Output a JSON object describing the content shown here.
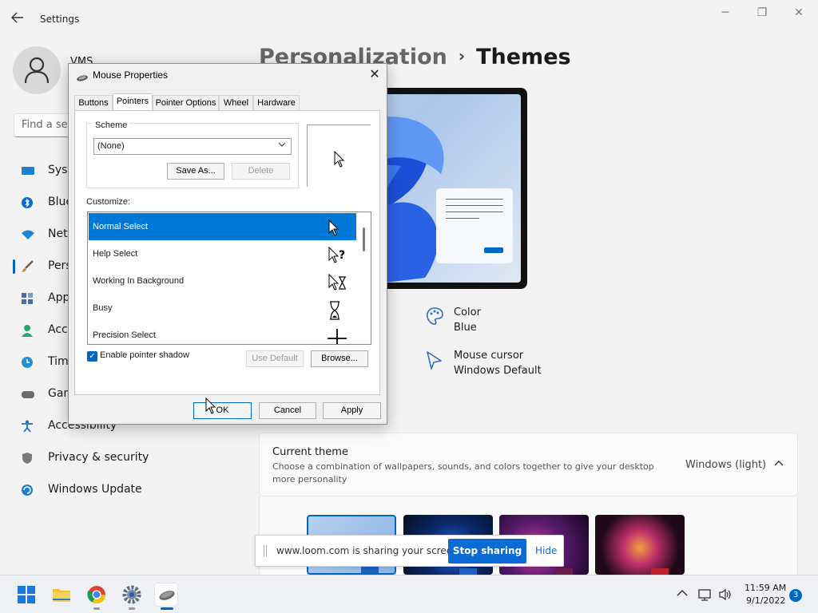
{
  "settings": {
    "app_title": "Settings",
    "user_name": "VMS",
    "search_placeholder": "Find a set",
    "nav": [
      {
        "label": "System",
        "icon": "system-icon",
        "color": "#1e7fcf"
      },
      {
        "label": "Bluetooth & devices",
        "icon": "bluetooth-icon",
        "color": "#0a6bd6"
      },
      {
        "label": "Network & internet",
        "icon": "wifi-icon",
        "color": "#1d85d8"
      },
      {
        "label": "Personalization",
        "icon": "brush-icon",
        "color": "#c88a3a",
        "active": true
      },
      {
        "label": "Apps",
        "icon": "apps-icon",
        "color": "#4a6fa8"
      },
      {
        "label": "Accounts",
        "icon": "accounts-icon",
        "color": "#2aa36b"
      },
      {
        "label": "Time & language",
        "icon": "time-icon",
        "color": "#2a90d6"
      },
      {
        "label": "Gaming",
        "icon": "gaming-icon",
        "color": "#6a6a6a"
      },
      {
        "label": "Accessibility",
        "icon": "accessibility-icon",
        "color": "#1a73c8"
      },
      {
        "label": "Privacy & security",
        "icon": "shield-icon",
        "color": "#7a7a7a"
      },
      {
        "label": "Windows Update",
        "icon": "update-icon",
        "color": "#1e7fcf"
      }
    ],
    "breadcrumb": {
      "parent": "Personalization",
      "separator": "›",
      "current": "Themes"
    },
    "options": {
      "color": {
        "title": "Color",
        "value": "Blue"
      },
      "cursor": {
        "title": "Mouse cursor",
        "value": "Windows Default"
      }
    },
    "current_theme": {
      "title": "Current theme",
      "subtitle": "Choose a combination of wallpapers, sounds, and colors together to give your desktop more personality",
      "value": "Windows (light)"
    }
  },
  "dialog": {
    "title": "Mouse Properties",
    "tabs": [
      "Buttons",
      "Pointers",
      "Pointer Options",
      "Wheel",
      "Hardware"
    ],
    "selected_tab": "Pointers",
    "scheme_label": "Scheme",
    "scheme_value": "(None)",
    "save_as": "Save As...",
    "delete": "Delete",
    "customize_label": "Customize:",
    "cursors": [
      {
        "label": "Normal Select",
        "icon": "arrow-cursor-icon"
      },
      {
        "label": "Help Select",
        "icon": "help-cursor-icon"
      },
      {
        "label": "Working In Background",
        "icon": "working-cursor-icon"
      },
      {
        "label": "Busy",
        "icon": "hourglass-cursor-icon"
      },
      {
        "label": "Precision Select",
        "icon": "crosshair-cursor-icon"
      }
    ],
    "shadow_label": "Enable pointer shadow",
    "shadow_checked": true,
    "use_default": "Use Default",
    "browse": "Browse...",
    "ok": "OK",
    "cancel": "Cancel",
    "apply": "Apply"
  },
  "loom": {
    "message": "www.loom.com is sharing your screen.",
    "stop": "Stop sharing",
    "hide": "Hide"
  },
  "taskbar": {
    "apps": [
      "start-icon",
      "file-explorer-icon",
      "chrome-icon",
      "settings-icon",
      "mouse-icon"
    ],
    "time": "11:59 AM",
    "date": "9/1/2022",
    "notifications": "3"
  }
}
